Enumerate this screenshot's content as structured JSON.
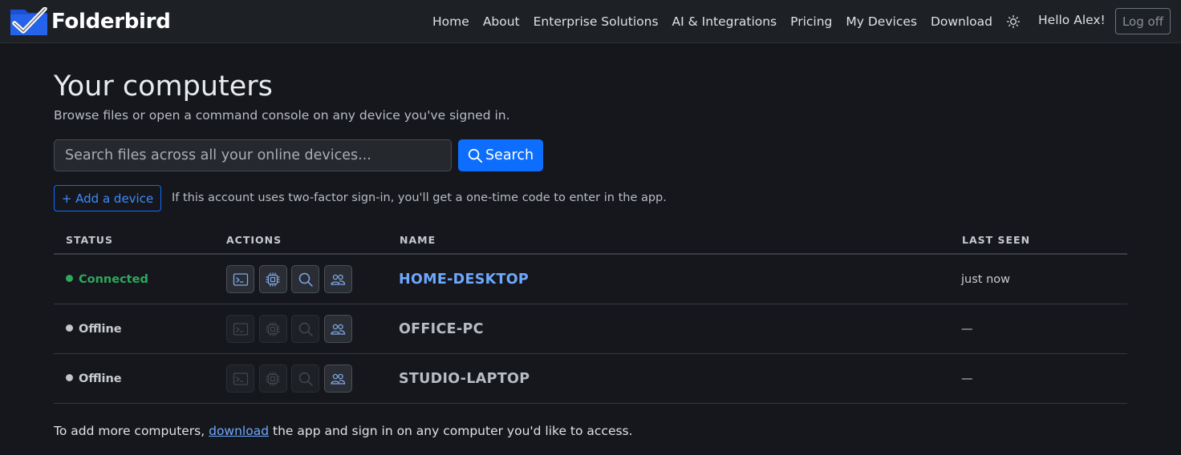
{
  "brand": {
    "name": "Folderbird"
  },
  "nav": {
    "links": [
      "Home",
      "About",
      "Enterprise Solutions",
      "AI & Integrations",
      "Pricing",
      "My Devices",
      "Download"
    ],
    "greeting": "Hello Alex!",
    "logoff": "Log off"
  },
  "page": {
    "title": "Your computers",
    "subtitle": "Browse files or open a command console on any device you've signed in."
  },
  "search": {
    "placeholder": "Search files across all your online devices...",
    "button": "Search"
  },
  "add_device": {
    "label": "+ Add a device",
    "hint": "If this account uses two-factor sign-in, you'll get a one-time code to enter in the app."
  },
  "table": {
    "headers": [
      "STATUS",
      "ACTIONS",
      "NAME",
      "LAST SEEN"
    ],
    "rows": [
      {
        "status": "Connected",
        "name": "HOME-DESKTOP",
        "last_seen": "just now"
      },
      {
        "status": "Offline",
        "name": "OFFICE-PC",
        "last_seen": "—"
      },
      {
        "status": "Offline",
        "name": "STUDIO-LAPTOP",
        "last_seen": "—"
      }
    ]
  },
  "footer": {
    "before": "To add more computers, ",
    "link": "download",
    "after": " the app and sign in on any computer you'd like to access."
  },
  "icons": {
    "actions": [
      "terminal-icon",
      "cpu-icon",
      "search-icon",
      "people-icon"
    ],
    "theme": "sun-icon"
  },
  "colors": {
    "accent": "#0d6efd",
    "link": "#6ea8fe",
    "online": "#2fa85e",
    "background": "#15171c"
  }
}
